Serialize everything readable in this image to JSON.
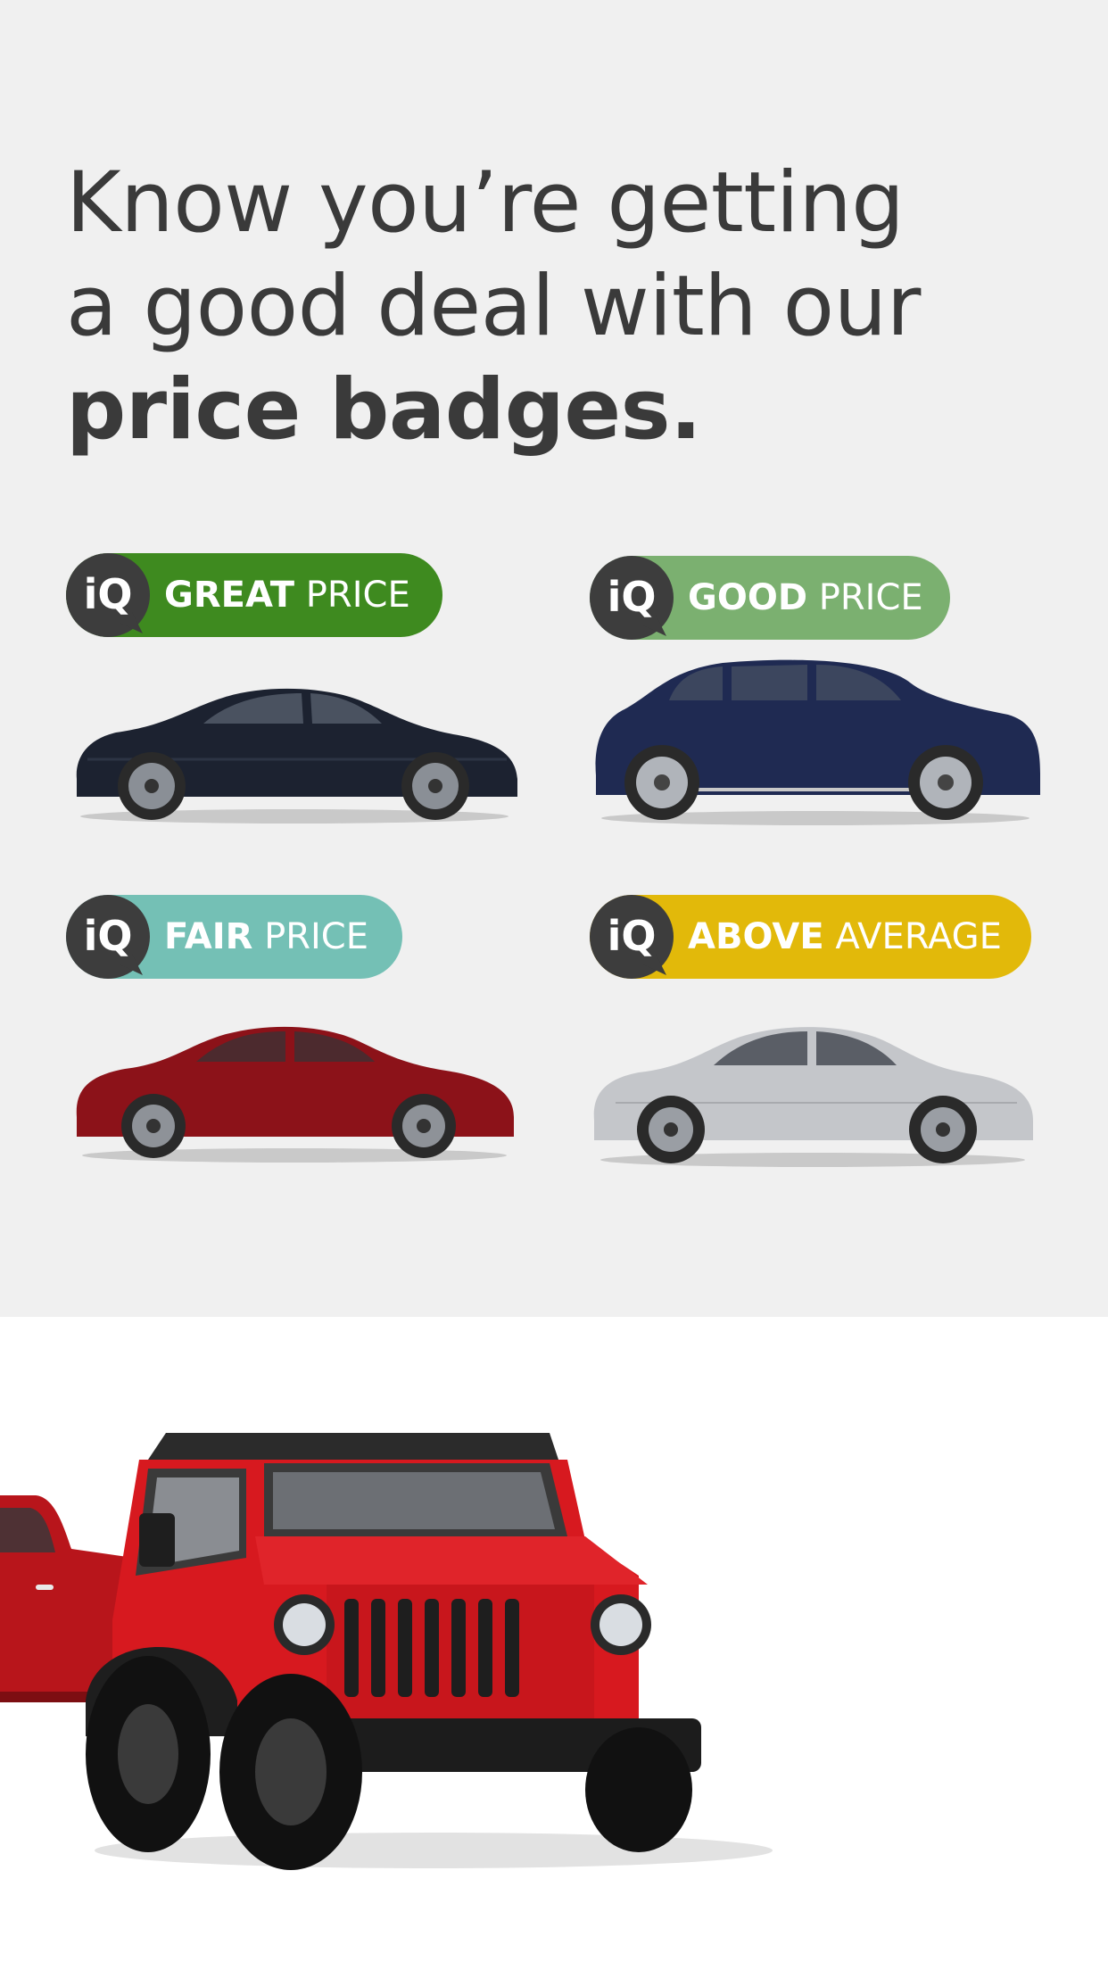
{
  "headline": {
    "line1": "Know you’re getting",
    "line2": "a good deal with our",
    "line3": "price badges."
  },
  "badges": [
    {
      "strong": "GREAT",
      "rest": " PRICE",
      "color": "#3e8a1f",
      "icon": "iq-logo-icon",
      "car": "dark-sedan"
    },
    {
      "strong": "GOOD",
      "rest": " PRICE",
      "color": "#7bb070",
      "icon": "iq-logo-icon",
      "car": "blue-suv"
    },
    {
      "strong": "FAIR",
      "rest": " PRICE",
      "color": "#74c0b5",
      "icon": "iq-logo-icon",
      "car": "red-sedan"
    },
    {
      "strong": "ABOVE",
      "rest": " AVERAGE",
      "color": "#e2b90a",
      "icon": "iq-logo-icon",
      "car": "silver-sedan"
    }
  ],
  "iq_logo": {
    "text": "iQ",
    "color": "#3d3d3d"
  },
  "hero": {
    "vehicles": [
      "red-jeep",
      "red-pickup-truck"
    ]
  }
}
